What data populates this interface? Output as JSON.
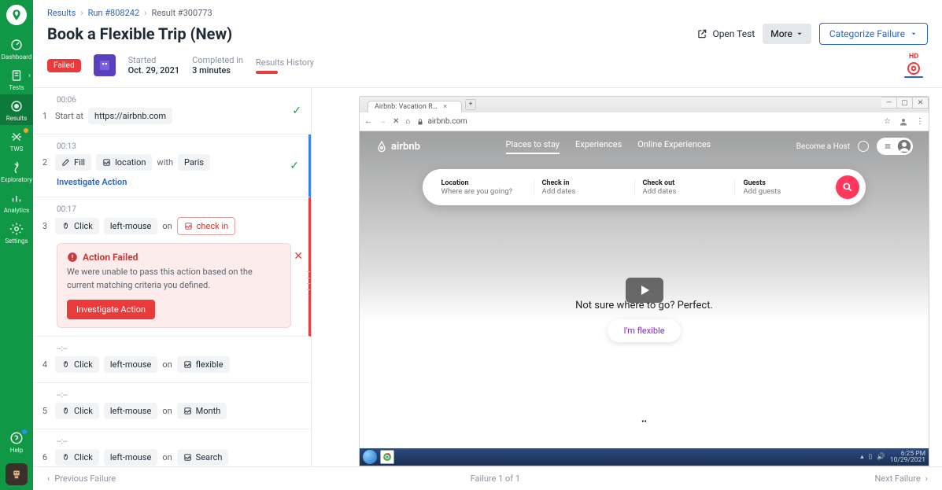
{
  "sidebar": {
    "items": [
      {
        "label": "Dashboard"
      },
      {
        "label": "Tests"
      },
      {
        "label": "Results"
      },
      {
        "label": "TWS"
      },
      {
        "label": "Exploratory"
      },
      {
        "label": "Analytics"
      },
      {
        "label": "Settings"
      }
    ],
    "help_label": "Help"
  },
  "crumbs": {
    "a": "Results",
    "b": "Run #808242",
    "c": "Result #300773"
  },
  "header": {
    "title": "Book a Flexible Trip (New)",
    "open_test": "Open Test",
    "more": "More",
    "categorize": "Categorize Failure"
  },
  "meta": {
    "status": "Failed",
    "started_lbl": "Started",
    "started_val": "Oct. 29, 2021",
    "completed_lbl": "Completed in",
    "completed_val": "3 minutes",
    "history_lbl": "Results History",
    "hd": "HD"
  },
  "steps": [
    {
      "ts": "00:06",
      "num": "1",
      "kind": "start",
      "label": "Start at",
      "url": "https://airbnb.com",
      "status": "pass"
    },
    {
      "ts": "00:13",
      "num": "2",
      "kind": "fill",
      "pills": [
        "Fill",
        "location"
      ],
      "conn": [
        "with"
      ],
      "tail": "Paris",
      "status": "pass",
      "investigate": "Investigate Action"
    },
    {
      "ts": "00:17",
      "num": "3",
      "kind": "click",
      "pills": [
        "Click",
        "left-mouse"
      ],
      "conn": [
        "on"
      ],
      "target": "check in",
      "status": "fail",
      "error": {
        "title": "Action Failed",
        "body": "We were unable to pass this action based on the current matching criteria you defined.",
        "btn": "Investigate Action"
      }
    },
    {
      "ts": "--:--",
      "num": "4",
      "kind": "click",
      "pills": [
        "Click",
        "left-mouse"
      ],
      "conn": [
        "on"
      ],
      "target_plain": "flexible"
    },
    {
      "ts": "--:--",
      "num": "5",
      "kind": "click",
      "pills": [
        "Click",
        "left-mouse"
      ],
      "conn": [
        "on"
      ],
      "target_plain": "Month"
    },
    {
      "ts": "--:--",
      "num": "6",
      "kind": "click",
      "pills": [
        "Click",
        "left-mouse"
      ],
      "conn": [
        "on"
      ],
      "target_plain": "Search"
    }
  ],
  "preview": {
    "tab_title": "Airbnb: Vacation Rentals, Cabins,",
    "url": "airbnb.com",
    "ab": {
      "brand": "airbnb",
      "nav": [
        "Places to stay",
        "Experiences",
        "Online Experiences"
      ],
      "become_host": "Become a Host",
      "search": [
        {
          "t": "Location",
          "s": "Where are you going?"
        },
        {
          "t": "Check in",
          "s": "Add dates"
        },
        {
          "t": "Check out",
          "s": "Add dates"
        },
        {
          "t": "Guests",
          "s": "Add guests"
        }
      ],
      "hero": "Not sure where to go? Perfect.",
      "flexible": "I'm flexible"
    },
    "clock_time": "6:25 PM",
    "clock_date": "10/29/2021"
  },
  "footer": {
    "prev": "Previous Failure",
    "counter": "Failure 1 of 1",
    "next": "Next Failure"
  }
}
